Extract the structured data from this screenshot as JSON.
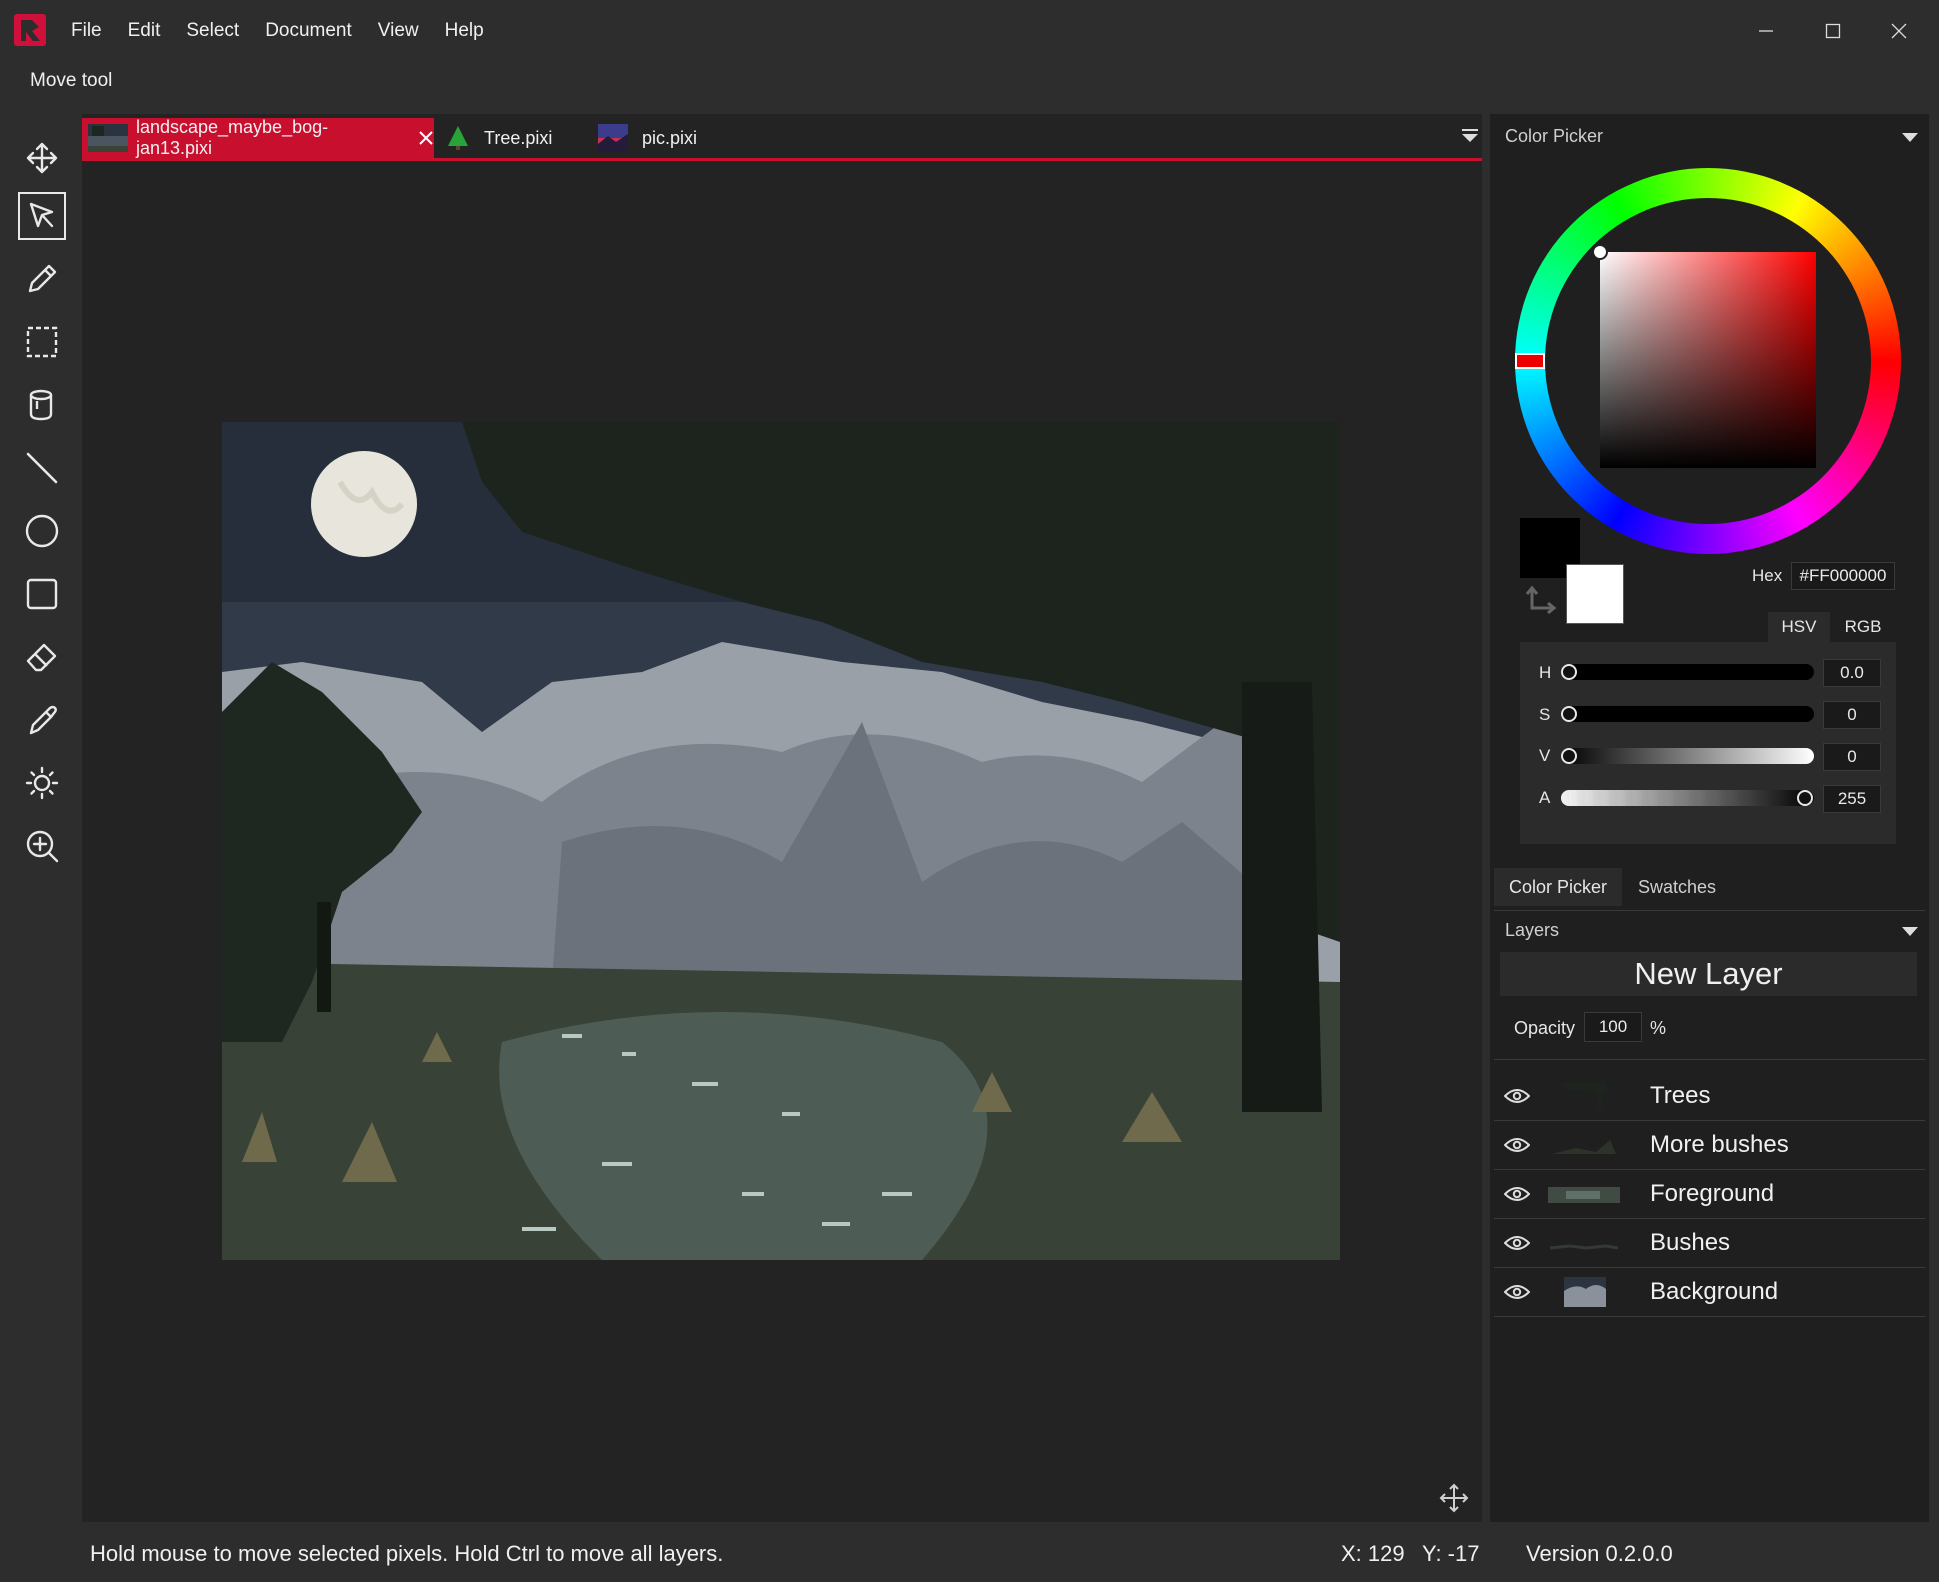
{
  "app": {
    "menu": [
      "File",
      "Edit",
      "Select",
      "Document",
      "View",
      "Help"
    ],
    "current_tool": "Move tool",
    "accent_color": "#c8102e",
    "window_controls": [
      "minimize-icon",
      "maximize-icon",
      "close-icon"
    ]
  },
  "toolbar": {
    "tools": [
      {
        "name": "move-tool",
        "icon": "move-arrows-icon",
        "active": false
      },
      {
        "name": "select-tool",
        "icon": "cursor-arrow-icon",
        "active": true
      },
      {
        "name": "pen-tool",
        "icon": "pencil-icon",
        "active": false
      },
      {
        "name": "rectangle-select-tool",
        "icon": "dashed-rect-icon",
        "active": false
      },
      {
        "name": "fill-tool",
        "icon": "bucket-icon",
        "active": false
      },
      {
        "name": "line-tool",
        "icon": "line-icon",
        "active": false
      },
      {
        "name": "ellipse-tool",
        "icon": "circle-icon",
        "active": false
      },
      {
        "name": "rectangle-tool",
        "icon": "square-icon",
        "active": false
      },
      {
        "name": "eraser-tool",
        "icon": "eraser-icon",
        "active": false
      },
      {
        "name": "color-picker-tool",
        "icon": "eyedropper-icon",
        "active": false
      },
      {
        "name": "brightness-tool",
        "icon": "sun-icon",
        "active": false
      },
      {
        "name": "zoom-tool",
        "icon": "magnifier-plus-icon",
        "active": false
      }
    ]
  },
  "documents": {
    "tabs": [
      {
        "label": "landscape_maybe_bog-jan13.pixi",
        "active": true
      },
      {
        "label": "Tree.pixi",
        "active": false
      },
      {
        "label": "pic.pixi",
        "active": false
      }
    ]
  },
  "color_picker": {
    "title": "Color Picker",
    "hex_label": "Hex",
    "hex_value": "#FF000000",
    "primary_color": "#000000",
    "secondary_color": "#ffffff",
    "modes": [
      "HSV",
      "RGB"
    ],
    "channels": [
      {
        "label": "H",
        "value": "0.0",
        "level": 0
      },
      {
        "label": "S",
        "value": "0",
        "level": 0
      },
      {
        "label": "V",
        "value": "0",
        "level": 0
      },
      {
        "label": "A",
        "value": "255",
        "level": 1
      }
    ],
    "panel_tabs": [
      "Color Picker",
      "Swatches"
    ]
  },
  "layers": {
    "title": "Layers",
    "new_layer_label": "New Layer",
    "opacity_label": "Opacity",
    "opacity_value": "100",
    "opacity_unit": "%",
    "items": [
      {
        "name": "Trees",
        "visible": true
      },
      {
        "name": "More bushes",
        "visible": true
      },
      {
        "name": "Foreground",
        "visible": true
      },
      {
        "name": "Bushes",
        "visible": true
      },
      {
        "name": "Background",
        "visible": true
      }
    ]
  },
  "status": {
    "hint": "Hold mouse to move selected pixels. Hold Ctrl to move all layers.",
    "x": "X: 129",
    "y": "Y: -17",
    "version": "Version 0.2.0.0"
  }
}
